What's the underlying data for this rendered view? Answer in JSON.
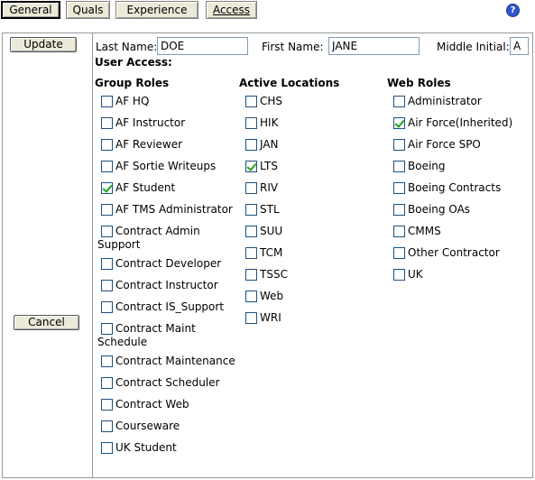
{
  "tabs": [
    {
      "label": "General",
      "selected": true
    },
    {
      "label": "Quals",
      "selected": false
    },
    {
      "label": "Experience",
      "selected": false
    },
    {
      "label": "Access",
      "selected": false
    }
  ],
  "help_icon": {
    "icon": "question-circle-icon",
    "glyph": "?"
  },
  "buttons": {
    "update": "Update",
    "cancel": "Cancel"
  },
  "name_fields": {
    "last_name_label": "Last Name:",
    "last_name_value": "DOE",
    "first_name_label": "First Name:",
    "first_name_value": "JANE",
    "middle_initial_label": "Middle Initial:",
    "middle_initial_value": "A"
  },
  "user_access_title": "User Access:",
  "group_roles": {
    "heading": "Group Roles",
    "items": [
      {
        "line1": "AF HQ",
        "line2": "",
        "checked": false
      },
      {
        "line1": "AF Instructor",
        "line2": "",
        "checked": false
      },
      {
        "line1": "AF Reviewer",
        "line2": "",
        "checked": false
      },
      {
        "line1": "AF Sortie Writeups",
        "line2": "",
        "checked": false
      },
      {
        "line1": "AF Student",
        "line2": "",
        "checked": true
      },
      {
        "line1": "AF TMS Administrator",
        "line2": "",
        "checked": false
      },
      {
        "line1": "Contract Admin",
        "line2": "Support",
        "checked": false
      },
      {
        "line1": "Contract Developer",
        "line2": "",
        "checked": false
      },
      {
        "line1": "Contract Instructor",
        "line2": "",
        "checked": false
      },
      {
        "line1": "Contract IS_Support",
        "line2": "",
        "checked": false
      },
      {
        "line1": "Contract Maint",
        "line2": "Schedule",
        "checked": false
      },
      {
        "line1": "Contract Maintenance",
        "line2": "",
        "checked": false
      },
      {
        "line1": "Contract Scheduler",
        "line2": "",
        "checked": false
      },
      {
        "line1": "Contract Web",
        "line2": "",
        "checked": false
      },
      {
        "line1": "Courseware",
        "line2": "",
        "checked": false
      },
      {
        "line1": "UK Student",
        "line2": "",
        "checked": false
      }
    ]
  },
  "active_locations": {
    "heading": "Active Locations",
    "items": [
      {
        "label": "CHS",
        "checked": false
      },
      {
        "label": "HIK",
        "checked": false
      },
      {
        "label": "JAN",
        "checked": false
      },
      {
        "label": "LTS",
        "checked": true
      },
      {
        "label": "RIV",
        "checked": false
      },
      {
        "label": "STL",
        "checked": false
      },
      {
        "label": "SUU",
        "checked": false
      },
      {
        "label": "TCM",
        "checked": false
      },
      {
        "label": "TSSC",
        "checked": false
      },
      {
        "label": "Web",
        "checked": false
      },
      {
        "label": "WRI",
        "checked": false
      }
    ]
  },
  "web_roles": {
    "heading": "Web Roles",
    "items": [
      {
        "label": "Administrator",
        "checked": false
      },
      {
        "label": "Air Force(Inherited)",
        "checked": true
      },
      {
        "label": "Air Force SPO",
        "checked": false
      },
      {
        "label": "Boeing",
        "checked": false
      },
      {
        "label": "Boeing Contracts",
        "checked": false
      },
      {
        "label": "Boeing OAs",
        "checked": false
      },
      {
        "label": "CMMS",
        "checked": false
      },
      {
        "label": "Other Contractor",
        "checked": false
      },
      {
        "label": "UK",
        "checked": false
      }
    ]
  },
  "colors": {
    "button_face": "#ece9d8",
    "checkbox_border": "#1c5180",
    "checkmark": "#21a121",
    "help_icon": "#2d56c8"
  }
}
